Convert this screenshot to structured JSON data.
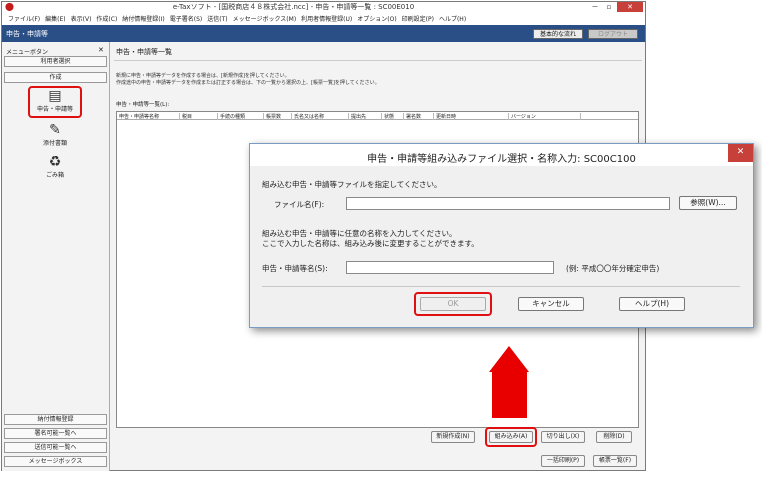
{
  "window": {
    "title": "e-Taxソフト - [国税商店４８株式会社.ncc] - 申告・申請等一覧 : SC00E010",
    "minimize": "－",
    "maximize": "▫",
    "close": "✕"
  },
  "menu": [
    "ファイル(F)",
    "編集(E)",
    "表示(V)",
    "作成(C)",
    "納付情報登録(I)",
    "電子署名(S)",
    "送信(T)",
    "メッセージボックス(M)",
    "利用者情報登録(U)",
    "オプション(O)",
    "印刷設定(P)",
    "ヘルプ(H)"
  ],
  "toolbar": {
    "caption": "申告・申請等",
    "basic_button": "基本的な流れ",
    "logout_button": "ログアウト"
  },
  "sidebar": {
    "header": "メニューボタン",
    "close": "✕",
    "user_select": "利用者選択",
    "create": "作成",
    "items": [
      {
        "label": "申告・申請等",
        "icon": "document-list-icon"
      },
      {
        "label": "添付書類",
        "icon": "attachment-document-icon"
      },
      {
        "label": "ごみ箱",
        "icon": "trash-can-icon"
      }
    ],
    "bottom_buttons": [
      "納付情報登録",
      "署名可能一覧へ",
      "送信可能一覧へ",
      "メッセージボックス"
    ]
  },
  "main": {
    "title": "申告・申請等一覧",
    "description_line1": "新規に申告・申請等データを作成する場合は、[新規作成]を押してください。",
    "description_line2": "作成途中の申告・申請等データを作成または訂正する場合は、下の一覧から選択の上、[帳票一覧]を押してください。",
    "list_label": "申告・申請等一覧(L):",
    "columns": [
      "申告・申請等名称",
      "税目",
      "手続の種類",
      "帳票数",
      "氏名又は名称",
      "提出先",
      "状態",
      "署名数",
      "更新日時",
      "バージョン"
    ],
    "buttons": {
      "new": "新規作成(N)",
      "import": "組み込み(A)",
      "export": "切り出し(X)",
      "delete": "削除(D)",
      "print_all": "一括印刷(P)",
      "form_list": "帳票一覧(F)"
    }
  },
  "dialog": {
    "title": "申告・申請等組み込みファイル選択・名称入力: SC00C100",
    "close": "✕",
    "instruction1": "組み込む申告・申請等ファイルを指定してください。",
    "file_label": "ファイル名(F):",
    "file_value": "",
    "browse": "参照(W)...",
    "instruction2": "組み込む申告・申請等に任意の名称を入力してください。",
    "instruction3": "ここで入力した名称は、組み込み後に変更することができます。",
    "name_label": "申告・申請等名(S):",
    "name_value": "",
    "name_example": "(例: 平成〇〇年分確定申告)",
    "ok": "OK",
    "cancel": "キャンセル",
    "help": "ヘルプ(H)"
  },
  "colors": {
    "toolbar_bg": "#2a4f87",
    "highlight": "#e01010",
    "close_button": "#c8403a"
  }
}
